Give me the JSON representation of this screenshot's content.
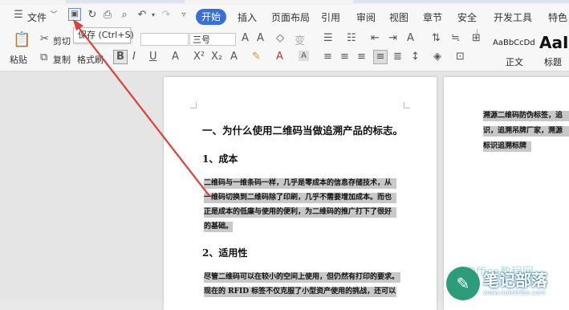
{
  "menubar": {
    "menu_label": "文件",
    "tabs": [
      "开始",
      "插入",
      "页面布局",
      "引用",
      "审阅",
      "视图",
      "章节",
      "安全",
      "开发工具",
      "特色"
    ],
    "active_tab": "开始"
  },
  "tooltip": {
    "text": "保存 (Ctrl+S)"
  },
  "ribbon": {
    "cut_label": "剪切",
    "paste_label": "粘贴",
    "copy_label": "复制",
    "format_painter_label": "格式刷",
    "font_size_value": "三号",
    "style_normal_label": "正文",
    "style_heading_label": "标题",
    "style_preview_normal": "AaBbCcDd",
    "style_preview_heading": "AaI"
  },
  "document": {
    "heading1": "一、为什么使用二维码当做追溯产品的标志。",
    "section1_title": "1、成本",
    "section1_lines": [
      "二维码与一维条码一样，几乎是零成本的信息存储技术，从",
      "一维码切换到二维码除了印刷，几乎不需要增加成本。而也",
      "正是成本的低廉与使用的便利，为二维码的推广打下了很好",
      "的基础。"
    ],
    "section2_title": "2、适用性",
    "section2_lines": [
      "尽管二维码可以在较小的空间上使用，但仍然有打印的要求。",
      "现在的 RFID 标签不仅克服了小型资产使用的挑战，还可以"
    ],
    "page2_lines": [
      "溯源二维码防伪标签，追",
      "识，追溯吊牌厂家，溯源",
      "标识追溯标牌"
    ]
  },
  "watermark": {
    "name": "笔记部落",
    "url": "www.notetribe.com",
    "faint": "Office教程网"
  },
  "colors": {
    "accent": "#3b6fd6",
    "arrow": "#d9413a",
    "selection": "#c8c8c8"
  }
}
